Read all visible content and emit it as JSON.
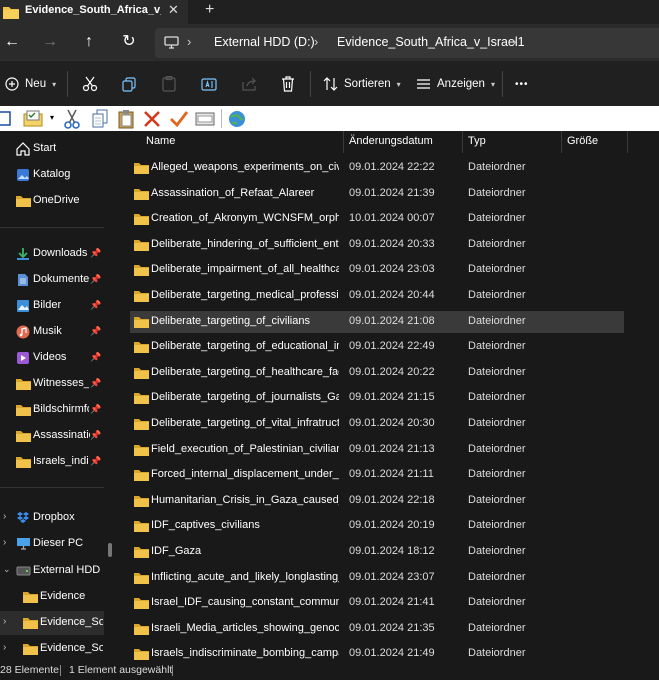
{
  "tab": {
    "title": "Evidence_South_Africa_v_Israe",
    "close": "✕",
    "new": "+"
  },
  "nav": {
    "back": "←",
    "forward": "→",
    "up": "↑",
    "refresh": "↻"
  },
  "address": {
    "segments": [
      "External HDD (D:)",
      "Evidence_South_Africa_v_Israel1"
    ],
    "chevron": "›"
  },
  "commands": {
    "new_label": "Neu",
    "sort_label": "Sortieren",
    "view_label": "Anzeigen",
    "more": "•••"
  },
  "sidebar": {
    "items": [
      {
        "label": "Start",
        "icon": "home-icon"
      },
      {
        "label": "Katalog",
        "icon": "gallery-icon"
      },
      {
        "label": "OneDrive",
        "icon": "folder-icon"
      },
      {
        "label": "Downloads",
        "icon": "downloads-icon",
        "pinned": true
      },
      {
        "label": "Dokumente",
        "icon": "documents-icon",
        "pinned": true
      },
      {
        "label": "Bilder",
        "icon": "pictures-icon",
        "pinned": true
      },
      {
        "label": "Musik",
        "icon": "music-icon",
        "pinned": true
      },
      {
        "label": "Videos",
        "icon": "videos-icon",
        "pinned": true
      },
      {
        "label": "Witnesses_Tw",
        "icon": "folder-icon",
        "pinned": true
      },
      {
        "label": "Bildschirmfo",
        "icon": "folder-icon",
        "pinned": true
      },
      {
        "label": "Assassination",
        "icon": "folder-icon",
        "pinned": true
      },
      {
        "label": "Israels_indisc",
        "icon": "folder-icon",
        "pinned": true
      },
      {
        "label": "Dropbox",
        "icon": "dropbox-icon"
      },
      {
        "label": "Dieser PC",
        "icon": "pc-icon"
      },
      {
        "label": "External HDD (D",
        "icon": "drive-icon"
      },
      {
        "label": "Evidence",
        "icon": "folder-icon"
      },
      {
        "label": "Evidence_Sout",
        "icon": "folder-icon"
      },
      {
        "label": "Evidence_Sout",
        "icon": "folder-icon"
      }
    ]
  },
  "columns": {
    "name": "Name",
    "date": "Änderungsdatum",
    "type": "Typ",
    "size": "Größe"
  },
  "files": [
    {
      "name": "Alleged_weapons_experiments_on_civilia...",
      "date": "09.01.2024 22:22",
      "type": "Dateiordner"
    },
    {
      "name": "Assassination_of_Refaat_Alareer",
      "date": "09.01.2024 21:39",
      "type": "Dateiordner"
    },
    {
      "name": "Creation_of_Akronym_WCNSFM_orphan...",
      "date": "10.01.2024 00:07",
      "type": "Dateiordner"
    },
    {
      "name": "Deliberate_hindering_of_sufficient_entry_...",
      "date": "09.01.2024 20:33",
      "type": "Dateiordner"
    },
    {
      "name": "Deliberate_impairment_of_all_healthcare...",
      "date": "09.01.2024 23:03",
      "type": "Dateiordner"
    },
    {
      "name": "Deliberate_targeting_medical_profession...",
      "date": "09.01.2024 20:44",
      "type": "Dateiordner"
    },
    {
      "name": "Deliberate_targeting_of_civilians",
      "date": "09.01.2024 21:08",
      "type": "Dateiordner"
    },
    {
      "name": "Deliberate_targeting_of_educational_insti...",
      "date": "09.01.2024 22:49",
      "type": "Dateiordner"
    },
    {
      "name": "Deliberate_targeting_of_healthcare_faciliti...",
      "date": "09.01.2024 20:22",
      "type": "Dateiordner"
    },
    {
      "name": "Deliberate_targeting_of_journalists_Gaza",
      "date": "09.01.2024 21:15",
      "type": "Dateiordner"
    },
    {
      "name": "Deliberate_targeting_of_vital_infratructure",
      "date": "09.01.2024 20:30",
      "type": "Dateiordner"
    },
    {
      "name": "Field_execution_of_Palestinian_civilians_i...",
      "date": "09.01.2024 21:13",
      "type": "Dateiordner"
    },
    {
      "name": "Forced_internal_displacement_under_dir...",
      "date": "09.01.2024 21:11",
      "type": "Dateiordner"
    },
    {
      "name": "Humanitarian_Crisis_in_Gaza_caused_by...",
      "date": "09.01.2024 22:18",
      "type": "Dateiordner"
    },
    {
      "name": "IDF_captives_civilians",
      "date": "09.01.2024 20:19",
      "type": "Dateiordner"
    },
    {
      "name": "IDF_Gaza",
      "date": "09.01.2024 18:12",
      "type": "Dateiordner"
    },
    {
      "name": "Inflicting_acute_and_likely_longlasting_...",
      "date": "09.01.2024 23:07",
      "type": "Dateiordner"
    },
    {
      "name": "Israel_IDF_causing_constant_communic...",
      "date": "09.01.2024 21:41",
      "type": "Dateiordner"
    },
    {
      "name": "Israeli_Media_articles_showing_genocidal...",
      "date": "09.01.2024 21:35",
      "type": "Dateiordner"
    },
    {
      "name": "Israels_indiscriminate_bombing_campaig...",
      "date": "09.01.2024 21:49",
      "type": "Dateiordner"
    }
  ],
  "selected_index": 6,
  "status": {
    "count": "28 Elemente",
    "selection": "1 Element ausgewählt"
  },
  "colors": {
    "folder": "#f0c24a",
    "folder_dark": "#d9a52b",
    "accent": "#4cc2ff",
    "bg": "#191919"
  }
}
